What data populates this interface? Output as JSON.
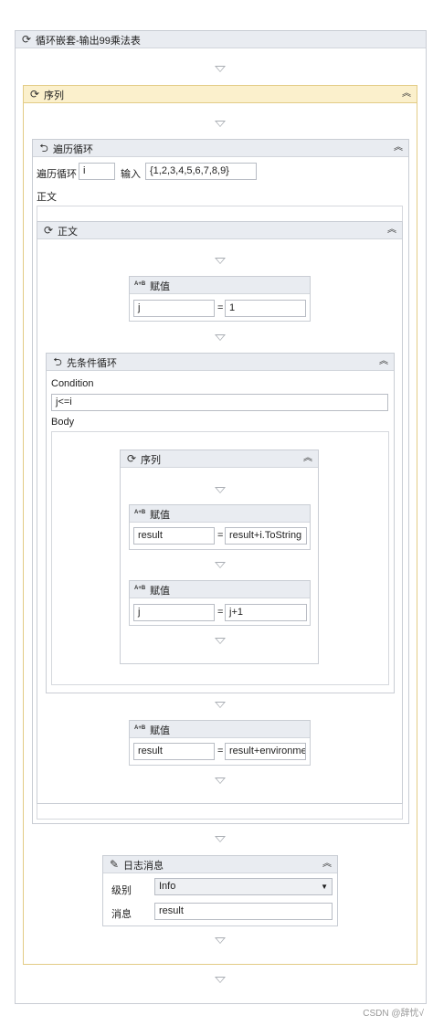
{
  "outer": {
    "title": "循环嵌套-输出99乘法表"
  },
  "sequence_main": {
    "title": "序列"
  },
  "foreach": {
    "title": "遍历循环",
    "loop_label": "遍历循环",
    "loop_var": "i",
    "input_label": "输入",
    "input_value": "{1,2,3,4,5,6,7,8,9}",
    "body_label": "正文"
  },
  "body_sequence": {
    "title": "正文"
  },
  "assign_j": {
    "title": "赋值",
    "left": "j",
    "right": "1"
  },
  "while": {
    "title": "先条件循环",
    "condition_label": "Condition",
    "condition_value": "j<=i",
    "body_label": "Body"
  },
  "inner_sequence": {
    "title": "序列"
  },
  "assign_result": {
    "title": "赋值",
    "left": "result",
    "right": "result+i.ToString"
  },
  "assign_j_inc": {
    "title": "赋值",
    "left": "j",
    "right": "j+1"
  },
  "assign_newline": {
    "title": "赋值",
    "left": "result",
    "right": "result+environme"
  },
  "log": {
    "title": "日志消息",
    "level_label": "级别",
    "level_value": "Info",
    "message_label": "消息",
    "message_value": "result"
  },
  "assign_icon_text": "A+B",
  "equals": "=",
  "watermark": "CSDN @辞忧√"
}
